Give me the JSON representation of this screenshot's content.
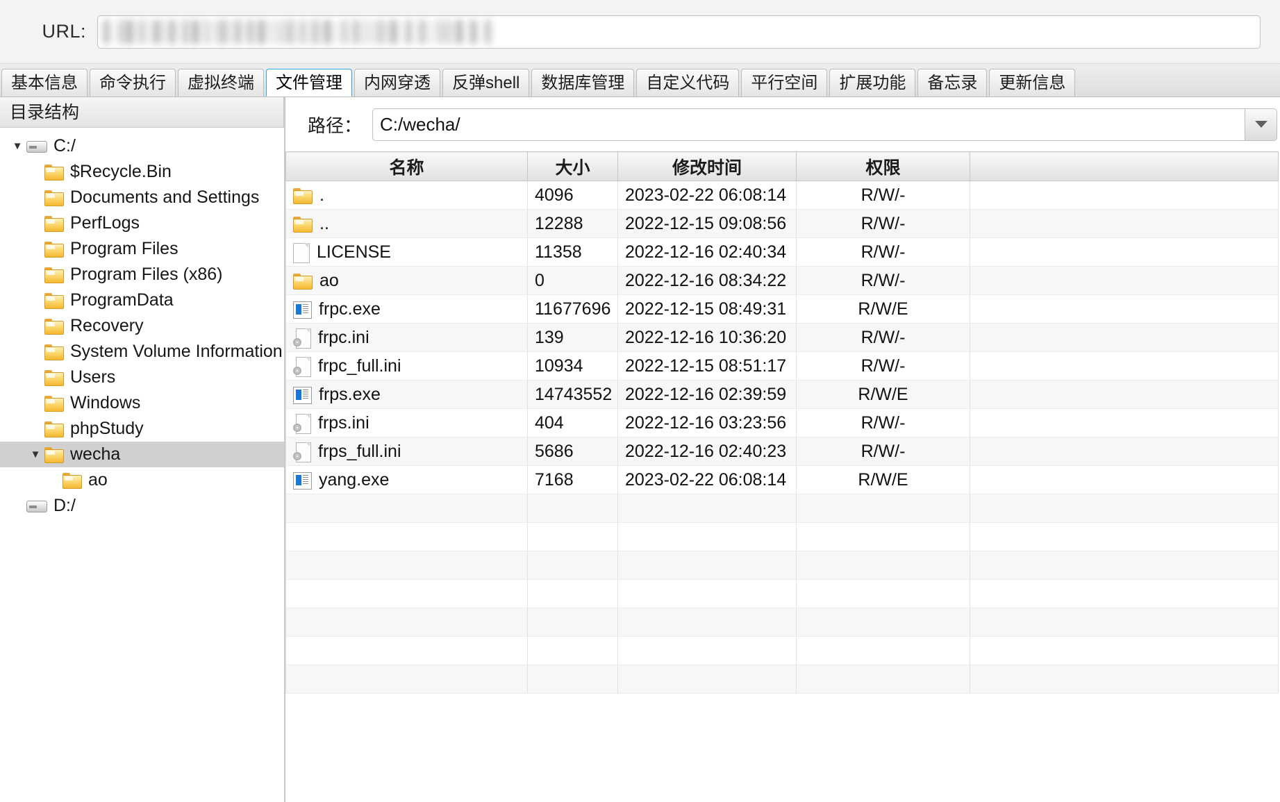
{
  "url_bar": {
    "label": "URL:",
    "value": "",
    "redacted": true
  },
  "tabs": [
    {
      "label": "基本信息",
      "active": false
    },
    {
      "label": "命令执行",
      "active": false
    },
    {
      "label": "虚拟终端",
      "active": false
    },
    {
      "label": "文件管理",
      "active": true
    },
    {
      "label": "内网穿透",
      "active": false
    },
    {
      "label": "反弹shell",
      "active": false
    },
    {
      "label": "数据库管理",
      "active": false
    },
    {
      "label": "自定义代码",
      "active": false
    },
    {
      "label": "平行空间",
      "active": false
    },
    {
      "label": "扩展功能",
      "active": false
    },
    {
      "label": "备忘录",
      "active": false
    },
    {
      "label": "更新信息",
      "active": false
    }
  ],
  "sidebar": {
    "header": "目录结构",
    "nodes": [
      {
        "label": "C:/",
        "icon": "drive-icon",
        "depth": 0,
        "twisty": "▼",
        "selected": false
      },
      {
        "label": "$Recycle.Bin",
        "icon": "folder-icon",
        "depth": 1,
        "twisty": "",
        "selected": false
      },
      {
        "label": "Documents and Settings",
        "icon": "folder-icon",
        "depth": 1,
        "twisty": "",
        "selected": false
      },
      {
        "label": "PerfLogs",
        "icon": "folder-icon",
        "depth": 1,
        "twisty": "",
        "selected": false
      },
      {
        "label": "Program Files",
        "icon": "folder-icon",
        "depth": 1,
        "twisty": "",
        "selected": false
      },
      {
        "label": "Program Files (x86)",
        "icon": "folder-icon",
        "depth": 1,
        "twisty": "",
        "selected": false
      },
      {
        "label": "ProgramData",
        "icon": "folder-icon",
        "depth": 1,
        "twisty": "",
        "selected": false
      },
      {
        "label": "Recovery",
        "icon": "folder-icon",
        "depth": 1,
        "twisty": "",
        "selected": false
      },
      {
        "label": "System Volume Information",
        "icon": "folder-icon",
        "depth": 1,
        "twisty": "",
        "selected": false
      },
      {
        "label": "Users",
        "icon": "folder-icon",
        "depth": 1,
        "twisty": "",
        "selected": false
      },
      {
        "label": "Windows",
        "icon": "folder-icon",
        "depth": 1,
        "twisty": "",
        "selected": false
      },
      {
        "label": "phpStudy",
        "icon": "folder-icon",
        "depth": 1,
        "twisty": "",
        "selected": false
      },
      {
        "label": "wecha",
        "icon": "folder-icon",
        "depth": 1,
        "twisty": "▼",
        "selected": true
      },
      {
        "label": "ao",
        "icon": "folder-icon",
        "depth": 2,
        "twisty": "",
        "selected": false
      },
      {
        "label": "D:/",
        "icon": "drive-icon",
        "depth": 0,
        "twisty": "",
        "selected": false
      }
    ]
  },
  "path_bar": {
    "label": "路径：",
    "value": "C:/wecha/",
    "dropdown_icon": "chevron-down-icon"
  },
  "file_table": {
    "columns": [
      "名称",
      "大小",
      "修改时间",
      "权限",
      ""
    ],
    "rows": [
      {
        "icon": "folder-icon",
        "name": ".",
        "size": "4096",
        "mtime": "2023-02-22 06:08:14",
        "perm": "R/W/-"
      },
      {
        "icon": "folder-icon",
        "name": "..",
        "size": "12288",
        "mtime": "2022-12-15 09:08:56",
        "perm": "R/W/-"
      },
      {
        "icon": "doc-icon",
        "name": "LICENSE",
        "size": "11358",
        "mtime": "2022-12-16 02:40:34",
        "perm": "R/W/-"
      },
      {
        "icon": "folder-icon",
        "name": "ao",
        "size": "0",
        "mtime": "2022-12-16 08:34:22",
        "perm": "R/W/-"
      },
      {
        "icon": "exe-icon",
        "name": "frpc.exe",
        "size": "11677696",
        "mtime": "2022-12-15 08:49:31",
        "perm": "R/W/E"
      },
      {
        "icon": "ini-icon",
        "name": "frpc.ini",
        "size": "139",
        "mtime": "2022-12-16 10:36:20",
        "perm": "R/W/-"
      },
      {
        "icon": "ini-icon",
        "name": "frpc_full.ini",
        "size": "10934",
        "mtime": "2022-12-15 08:51:17",
        "perm": "R/W/-"
      },
      {
        "icon": "exe-icon",
        "name": "frps.exe",
        "size": "14743552",
        "mtime": "2022-12-16 02:39:59",
        "perm": "R/W/E"
      },
      {
        "icon": "ini-icon",
        "name": "frps.ini",
        "size": "404",
        "mtime": "2022-12-16 03:23:56",
        "perm": "R/W/-"
      },
      {
        "icon": "ini-icon",
        "name": "frps_full.ini",
        "size": "5686",
        "mtime": "2022-12-16 02:40:23",
        "perm": "R/W/-"
      },
      {
        "icon": "exe-icon",
        "name": "yang.exe",
        "size": "7168",
        "mtime": "2023-02-22 06:08:14",
        "perm": "R/W/E"
      }
    ],
    "empty_row_count": 7
  },
  "colors": {
    "accent": "#2aa8e0",
    "selection": "#d0d0d0",
    "folder": "#f5b731",
    "exe_blue": "#1878d4"
  }
}
